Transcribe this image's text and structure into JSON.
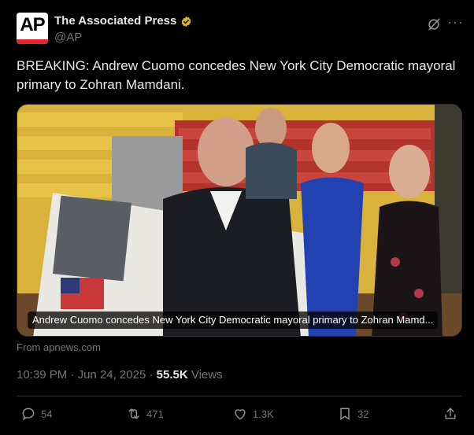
{
  "post": {
    "author_name": "The Associated Press",
    "handle": "@AP",
    "avatar_text": "AP",
    "text": "BREAKING: Andrew Cuomo concedes New York City Democratic mayoral primary to Zohran Mamdani.",
    "media_caption": "Andrew Cuomo concedes New York City Democratic mayoral primary to Zohran Mamd...",
    "source": "From apnews.com",
    "time": "10:39 PM",
    "separator": "·",
    "date": "Jun 24, 2025",
    "views_count": "55.5K",
    "views_label": "Views",
    "more_icon": "···"
  },
  "actions": {
    "replies": "54",
    "reposts": "471",
    "likes": "1.3K",
    "bookmarks": "32"
  },
  "icons": {
    "verified": "verified-badge-icon",
    "grok": "grok-icon",
    "more": "more-icon",
    "reply": "reply-icon",
    "repost": "repost-icon",
    "like": "heart-icon",
    "bookmark": "bookmark-icon",
    "share": "share-icon"
  },
  "colors": {
    "background": "#000000",
    "text": "#e7e9ea",
    "muted": "#71767b",
    "verified_gold": "#e2b719",
    "ap_red": "#e0262b"
  }
}
